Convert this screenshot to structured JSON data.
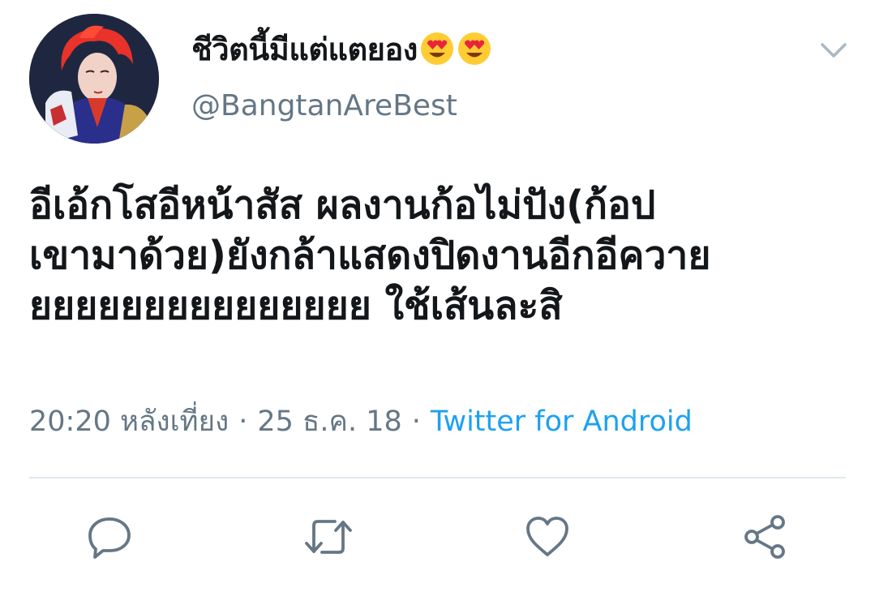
{
  "tweet": {
    "display_name": "ชีวิตนี้มีแต่แตยอง",
    "display_name_emoji": "heart-eyes-emoji",
    "handle": "@BangtanAreBest",
    "text": "อีเอ้กโสอีหน้าสัส ผลงานก้อไม่ปัง(ก้อป\nเขามาด้วย)ยังกล้าแสดงปิดงานอีกอีควาย\nยยยยยยยยยยยยยยย ใช้เส้นละสิ",
    "time": "20:20 หลังเที่ยง",
    "separator": "·",
    "date": "25 ธ.ค. 18",
    "source": "Twitter for Android"
  },
  "icons": {
    "menu": "chevron-down-icon",
    "reply": "reply-icon",
    "retweet": "retweet-icon",
    "like": "heart-icon",
    "share": "share-icon"
  },
  "colors": {
    "text": "#14171a",
    "secondary": "#657786",
    "link": "#1da1f2",
    "divider": "#e1e8ed"
  }
}
